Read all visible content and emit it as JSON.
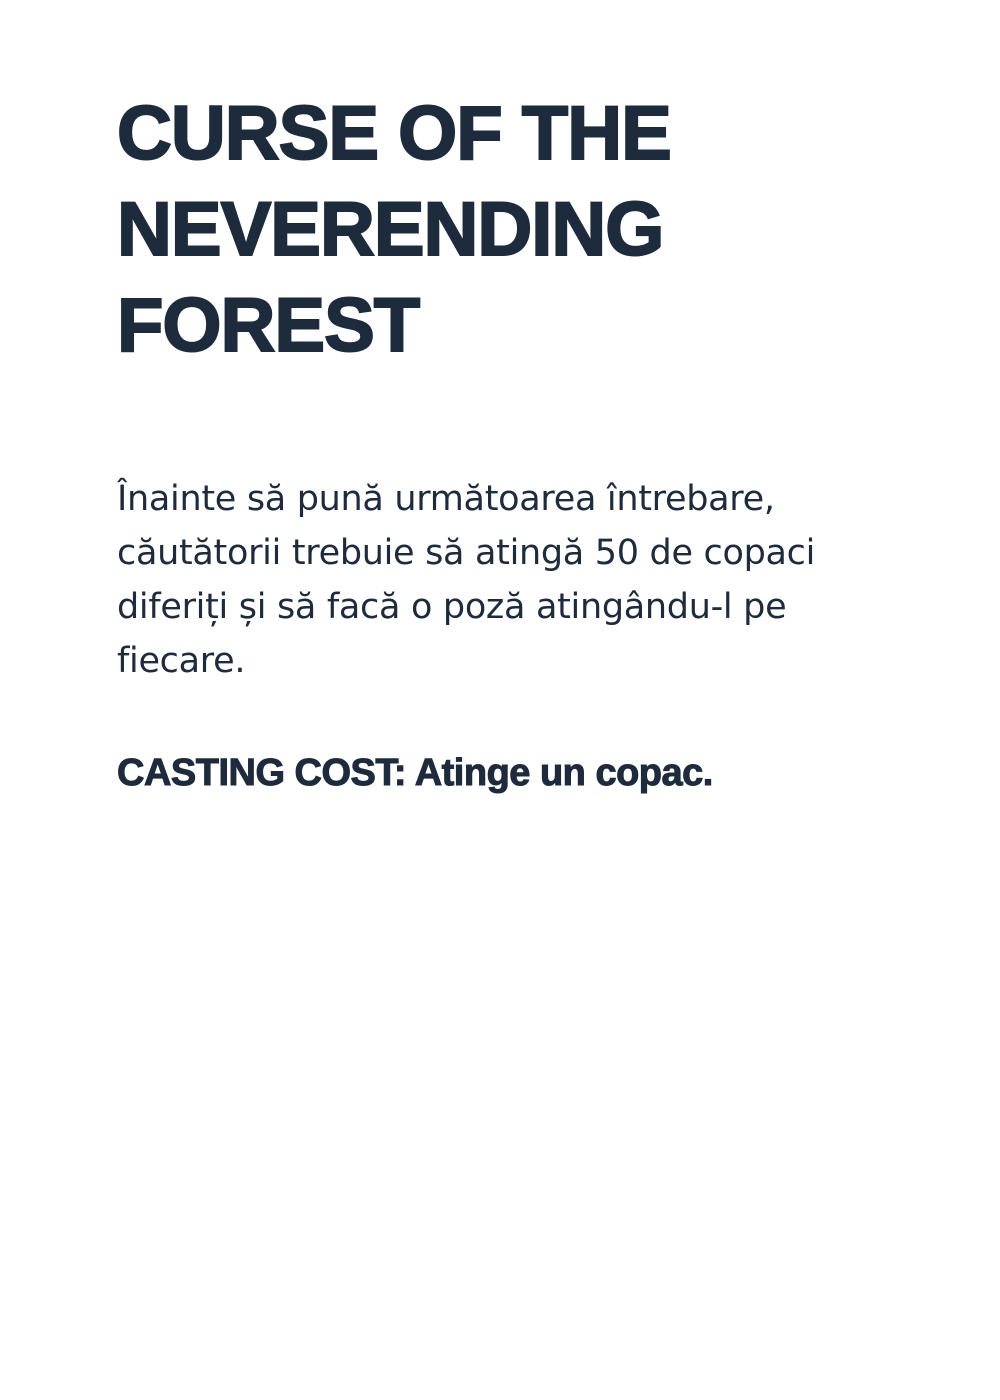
{
  "card": {
    "title_lines": [
      "CURSE OF THE",
      "NEVERENDING",
      "FOREST"
    ],
    "description": "Înainte să pună următoarea întrebare, căutătorii trebuie să atingă 50 de copaci diferiți și să facă o poză atingându-l pe fiecare.",
    "casting_cost": "CASTING COST: Atinge un copac."
  },
  "colors": {
    "text": "#1e2b3c",
    "background": "#ffffff"
  }
}
